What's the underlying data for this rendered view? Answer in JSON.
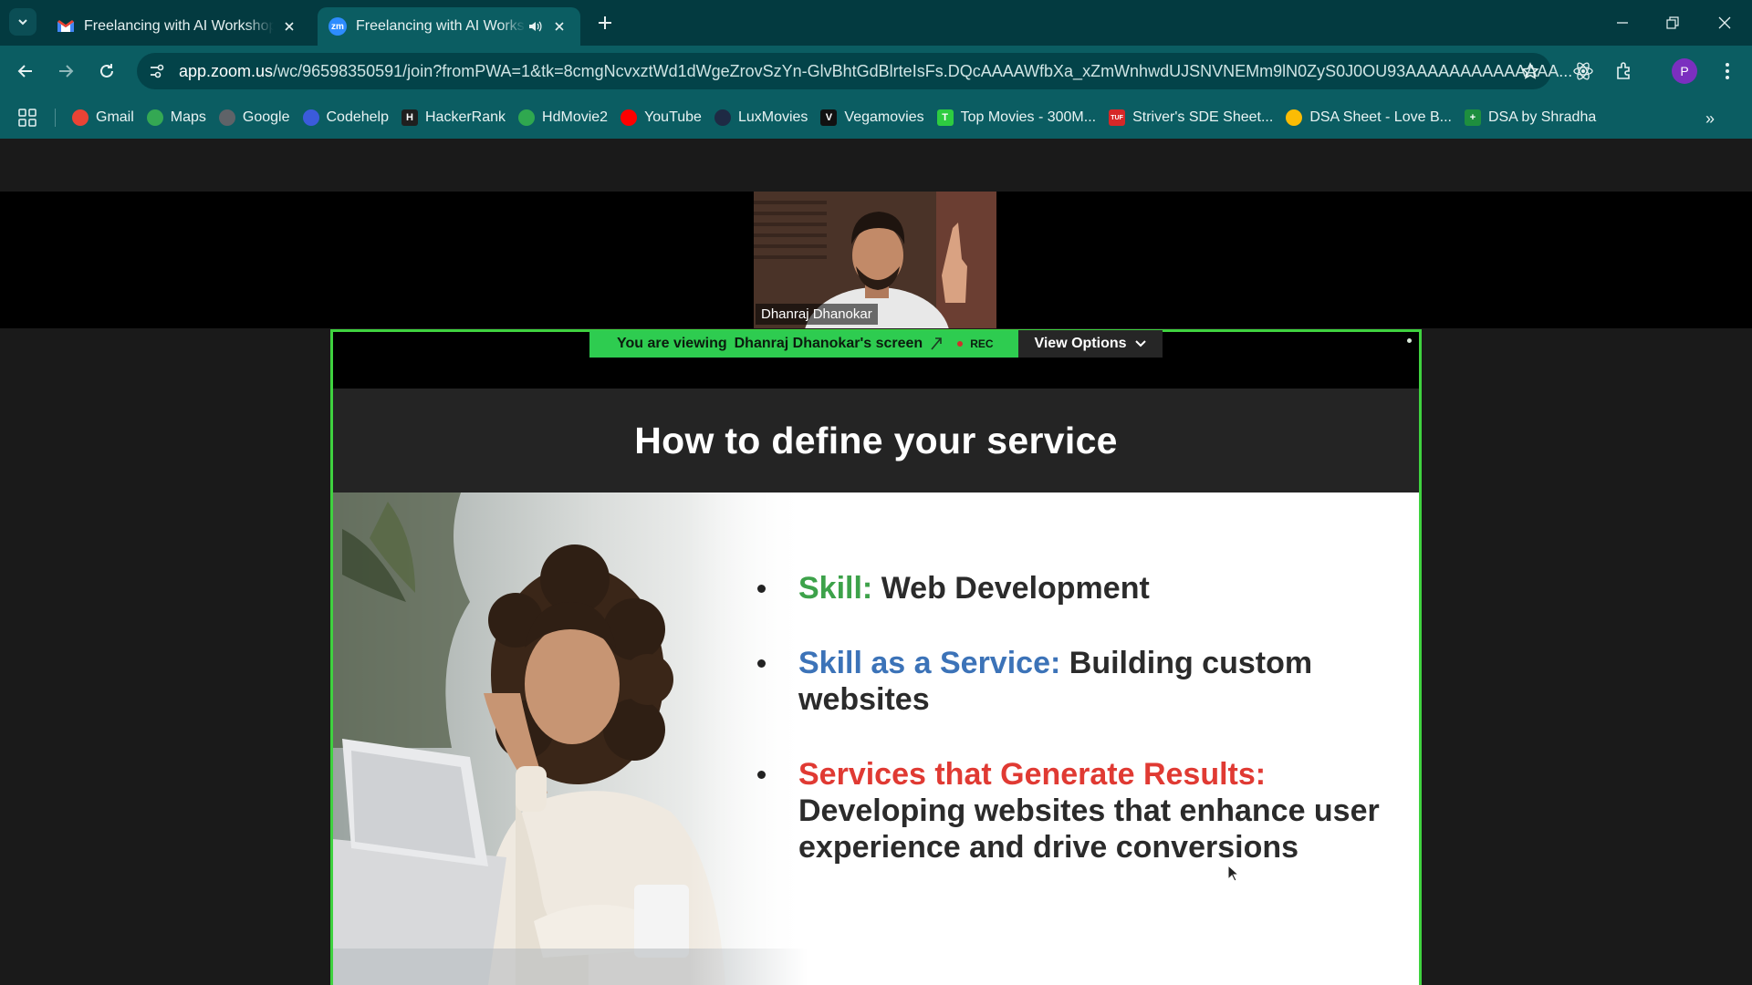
{
  "browser": {
    "tabs": [
      {
        "title": "Freelancing with AI Workshop C",
        "favicon": "gmail-icon",
        "active": false
      },
      {
        "title": "Freelancing with AI Workshop",
        "favicon": "zoom-icon",
        "active": true,
        "favicon_text": "zm"
      }
    ],
    "url_host": "app.zoom.us",
    "url_path": "/wc/96598350591/join?fromPWA=1&tk=8cmgNcvxztWd1dWgeZrovSzYn-GlvBhtGdBlrteIsFs.DQcAAAAWfbXa_xZmWnhwdUJSNVNEMm9lN0ZyS0J0OU93AAAAAAAAAAAAAA...",
    "profile_initial": "P",
    "bookmarks": [
      {
        "label": "Gmail",
        "icon": "gmail-icon",
        "color": "#ea4335"
      },
      {
        "label": "Maps",
        "icon": "maps-icon",
        "color": "#34a853"
      },
      {
        "label": "Google",
        "icon": "globe-icon",
        "color": "#5f6368"
      },
      {
        "label": "Codehelp",
        "icon": "codehelp-icon",
        "color": "#3b5bdb"
      },
      {
        "label": "HackerRank",
        "icon": "hackerrank-icon",
        "color": "#1f1f1f",
        "glyph": "H"
      },
      {
        "label": "HdMovie2",
        "icon": "hdmovie-icon",
        "color": "#2fa84f"
      },
      {
        "label": "YouTube",
        "icon": "youtube-icon",
        "color": "#ff0000"
      },
      {
        "label": "LuxMovies",
        "icon": "luxmovies-icon",
        "color": "#1e2a44"
      },
      {
        "label": "Vegamovies",
        "icon": "vegamovies-icon",
        "color": "#111111",
        "glyph": "V"
      },
      {
        "label": "Top Movies - 300M...",
        "icon": "topmovies-icon",
        "color": "#2ecc40",
        "glyph": "T"
      },
      {
        "label": "Striver's SDE Sheet...",
        "icon": "striver-icon",
        "color": "#d62828",
        "glyph": "TUF"
      },
      {
        "label": "DSA Sheet - Love B...",
        "icon": "drive-icon",
        "color": "#fbbc04"
      },
      {
        "label": "DSA by Shradha",
        "icon": "sheets-icon",
        "color": "#1e8e3e",
        "glyph": "+"
      }
    ]
  },
  "zoom": {
    "participant_name": "Dhanraj Dhanokar",
    "share_prefix": "You are viewing",
    "share_owner": "Dhanraj Dhanokar's screen",
    "rec_label": "REC",
    "view_options_label": "View Options"
  },
  "slide": {
    "title": "How to define your service",
    "bullets": [
      {
        "key": "Skill:",
        "text": " Web Development",
        "key_color": "green"
      },
      {
        "key": "Skill as a Service:",
        "text": " Building custom websites",
        "key_color": "blue"
      },
      {
        "key": "Services that Generate Results:",
        "text": " Developing websites that enhance user experience and drive conversions",
        "key_color": "red"
      }
    ]
  }
}
